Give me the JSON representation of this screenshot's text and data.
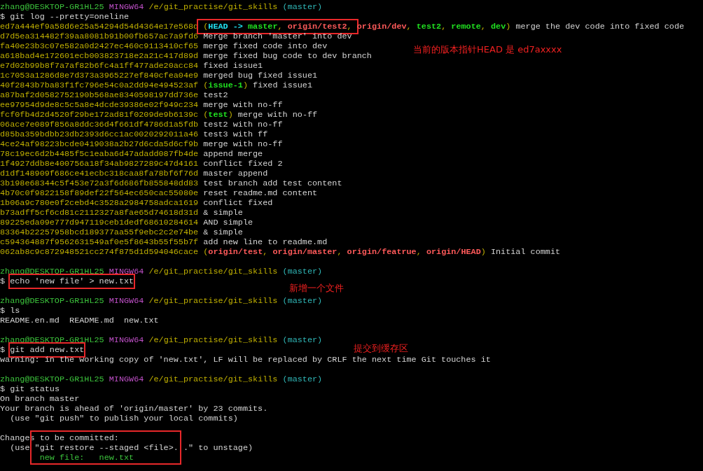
{
  "sessions": [
    {
      "prompt": {
        "user": "zhang@DESKTOP-GR1HL25",
        "host": "MINGW64",
        "path": "/e/git_practise/git_skills",
        "branch": "(master)"
      },
      "command": {
        "symbol": "$",
        "text": "git log --pretty=oneline",
        "highlighted": false
      },
      "output_blocks": [
        [
          {
            "segments": [
              {
                "kind": "hash",
                "text": "ed7a444ef9a58d6e25a54294d54d4364e17e568d"
              },
              {
                "kind": "frame",
                "segments": [
                  {
                    "kind": "punct",
                    "text": " ("
                  },
                  {
                    "kind": "head",
                    "text": "HEAD -> "
                  },
                  {
                    "kind": "local",
                    "text": "master"
                  },
                  {
                    "kind": "punct",
                    "text": ", "
                  },
                  {
                    "kind": "remote",
                    "text": "origin/test2"
                  },
                  {
                    "kind": "punct",
                    "text": ", "
                  }
                ]
              },
              {
                "kind": "remote",
                "text": "origin/dev"
              },
              {
                "kind": "punct",
                "text": ", "
              },
              {
                "kind": "local",
                "text": "test2"
              },
              {
                "kind": "punct",
                "text": ", "
              },
              {
                "kind": "local",
                "text": "remote"
              },
              {
                "kind": "punct",
                "text": ", "
              },
              {
                "kind": "local",
                "text": "dev"
              },
              {
                "kind": "punct",
                "text": ")"
              },
              {
                "kind": "plain",
                "text": " merge the dev code into fixed code"
              }
            ]
          },
          {
            "segments": [
              {
                "kind": "hash",
                "text": "d7d5ea314482f39aa8081b91b00fb657ac7a9fd6"
              },
              {
                "kind": "plain",
                "text": " Merge branch 'master' into dev"
              }
            ]
          },
          {
            "segments": [
              {
                "kind": "hash",
                "text": "fa40e23b3c07e582a0d2427ec460c9113410cf65"
              },
              {
                "kind": "plain",
                "text": " merge fixed code into dev"
              }
            ]
          },
          {
            "segments": [
              {
                "kind": "hash",
                "text": "a618bad4e172601ecb003823718e2a21c417d89d"
              },
              {
                "kind": "plain",
                "text": " merge fixed bug code to dev branch"
              }
            ]
          },
          {
            "segments": [
              {
                "kind": "hash",
                "text": "e7d02b99b8f7a7af82b6fc4a1ff477ade20acc84"
              },
              {
                "kind": "plain",
                "text": " fixed issue1"
              }
            ]
          },
          {
            "segments": [
              {
                "kind": "hash",
                "text": "1c7053a1286d8e7d373a3965227ef840cfea04e9"
              },
              {
                "kind": "plain",
                "text": " merged bug fixed issue1"
              }
            ]
          },
          {
            "segments": [
              {
                "kind": "hash",
                "text": "40f2843b7ba83f1fc796e54c0a2dd94e494523af"
              },
              {
                "kind": "punct",
                "text": " ("
              },
              {
                "kind": "local",
                "text": "issue-1"
              },
              {
                "kind": "punct",
                "text": ")"
              },
              {
                "kind": "plain",
                "text": " fixed issue1"
              }
            ]
          },
          {
            "segments": [
              {
                "kind": "hash",
                "text": "a87baf2d0582752190b568ae8340598197dd736e"
              },
              {
                "kind": "plain",
                "text": " test2"
              }
            ]
          },
          {
            "segments": [
              {
                "kind": "hash",
                "text": "ee97954d9de8c5c5a8e4dcde39386e02f949c234"
              },
              {
                "kind": "plain",
                "text": " merge with no-ff"
              }
            ]
          },
          {
            "segments": [
              {
                "kind": "hash",
                "text": "fcf0fb4d2d4520f29be172ad81f0209de9b6139c"
              },
              {
                "kind": "punct",
                "text": " ("
              },
              {
                "kind": "local",
                "text": "test"
              },
              {
                "kind": "punct",
                "text": ")"
              },
              {
                "kind": "plain",
                "text": " merge with no-ff"
              }
            ]
          },
          {
            "segments": [
              {
                "kind": "hash",
                "text": "06ace7e089f856a8ddc36d4f661df4786d1a5fdb"
              },
              {
                "kind": "plain",
                "text": " test2 with no-ff"
              }
            ]
          },
          {
            "segments": [
              {
                "kind": "hash",
                "text": "d85ba359bdbb23db2393d6cc1ac0020292011a46"
              },
              {
                "kind": "plain",
                "text": " test3 with ff"
              }
            ]
          },
          {
            "segments": [
              {
                "kind": "hash",
                "text": "4ce24af98223bcde0419038a2b27d6cda5d6cf9b"
              },
              {
                "kind": "plain",
                "text": " merge with no-ff"
              }
            ]
          },
          {
            "segments": [
              {
                "kind": "hash",
                "text": "78c19ec6d2b4485f5c1eaba6d47adadd087fb4de"
              },
              {
                "kind": "plain",
                "text": " append merge"
              }
            ]
          },
          {
            "segments": [
              {
                "kind": "hash",
                "text": "1f4927ddb8e400756a18f34ab9827289c47d4161"
              },
              {
                "kind": "plain",
                "text": " conflict fixed 2"
              }
            ]
          },
          {
            "segments": [
              {
                "kind": "hash",
                "text": "d1df148909f686ce41ecbc318caa8fa78bf6f76d"
              },
              {
                "kind": "plain",
                "text": " master append"
              }
            ]
          },
          {
            "segments": [
              {
                "kind": "hash",
                "text": "3b198e68344c5f453e72a3f6d686fb855848dd83"
              },
              {
                "kind": "plain",
                "text": " test branch add test content"
              }
            ]
          },
          {
            "segments": [
              {
                "kind": "hash",
                "text": "4b70c0f9822158f89def22f564ec650cac55080e"
              },
              {
                "kind": "plain",
                "text": " reset readme.md content"
              }
            ]
          },
          {
            "segments": [
              {
                "kind": "hash",
                "text": "1b06a9c780e0f2cebd4c3528a2984758adca1619"
              },
              {
                "kind": "plain",
                "text": " conflict fixed"
              }
            ]
          },
          {
            "segments": [
              {
                "kind": "hash",
                "text": "b73adff5cf6cd81c2112327a8fae65d74618d31d"
              },
              {
                "kind": "plain",
                "text": " & simple"
              }
            ]
          },
          {
            "segments": [
              {
                "kind": "hash",
                "text": "89225eda09e777d947119ceb1dedf68610284614"
              },
              {
                "kind": "plain",
                "text": " AND simple"
              }
            ]
          },
          {
            "segments": [
              {
                "kind": "hash",
                "text": "83364b22257958bcd189377aa55f9ebc2c2e74be"
              },
              {
                "kind": "plain",
                "text": " & simple"
              }
            ]
          },
          {
            "segments": [
              {
                "kind": "hash",
                "text": "c594364887f9562631549af0e5f8643b55f55b7f"
              },
              {
                "kind": "plain",
                "text": " add new line to readme.md"
              }
            ]
          },
          {
            "segments": [
              {
                "kind": "hash",
                "text": "062ab8c9c872948521cc274f875d1d594046cace"
              },
              {
                "kind": "punct",
                "text": " ("
              },
              {
                "kind": "remote",
                "text": "origin/test"
              },
              {
                "kind": "punct",
                "text": ", "
              },
              {
                "kind": "remote",
                "text": "origin/master"
              },
              {
                "kind": "punct",
                "text": ", "
              },
              {
                "kind": "remote",
                "text": "origin/featrue"
              },
              {
                "kind": "punct",
                "text": ", "
              },
              {
                "kind": "remote",
                "text": "origin/HEAD"
              },
              {
                "kind": "punct",
                "text": ")"
              },
              {
                "kind": "plain",
                "text": " Initial commit"
              }
            ]
          }
        ]
      ]
    },
    {
      "prompt": {
        "user": "zhang@DESKTOP-GR1HL25",
        "host": "MINGW64",
        "path": "/e/git_practise/git_skills",
        "branch": "(master)"
      },
      "command": {
        "symbol": "$",
        "text": "echo 'new file' > new.txt",
        "highlighted": true
      }
    },
    {
      "prompt": {
        "user": "zhang@DESKTOP-GR1HL25",
        "host": "MINGW64",
        "path": "/e/git_practise/git_skills",
        "branch": "(master)"
      },
      "command": {
        "symbol": "$",
        "text": "ls",
        "highlighted": false
      },
      "output_blocks": [
        [
          {
            "segments": [
              {
                "kind": "plain",
                "text": "README.en.md  README.md  new.txt"
              }
            ]
          }
        ]
      ]
    },
    {
      "prompt": {
        "user": "zhang@DESKTOP-GR1HL25",
        "host": "MINGW64",
        "path": "/e/git_practise/git_skills",
        "branch": "(master)"
      },
      "command": {
        "symbol": "$",
        "text": "git add new.txt",
        "highlighted": true
      },
      "output_blocks": [
        [
          {
            "segments": [
              {
                "kind": "plain",
                "text": "warning: in the working copy of 'new.txt', LF will be replaced by CRLF the next time Git touches it"
              }
            ]
          }
        ]
      ]
    },
    {
      "prompt": {
        "user": "zhang@DESKTOP-GR1HL25",
        "host": "MINGW64",
        "path": "/e/git_practise/git_skills",
        "branch": "(master)"
      },
      "command": {
        "symbol": "$",
        "text": "git status",
        "highlighted": false
      },
      "output_blocks": [
        [
          {
            "segments": [
              {
                "kind": "plain",
                "text": "On branch master"
              }
            ]
          },
          {
            "segments": [
              {
                "kind": "plain",
                "text": "Your branch is ahead of 'origin/master' by 23 commits."
              }
            ]
          },
          {
            "segments": [
              {
                "kind": "plain",
                "text": "  (use \"git push\" to publish your local commits)"
              }
            ]
          }
        ],
        [
          {
            "segments": [
              {
                "kind": "plain",
                "text": "Changes to be committed:"
              }
            ]
          },
          {
            "segments": [
              {
                "kind": "plain",
                "text": "  (use \"git restore --staged <file>...\" to unstage)"
              }
            ]
          },
          {
            "segments": [
              {
                "kind": "staged",
                "text": "        new file:   new.txt"
              }
            ]
          }
        ]
      ]
    }
  ],
  "notes": [
    "当前的版本指针HEAD 是 ed7axxxx",
    "新增一个文件",
    "提交到缓存区"
  ]
}
